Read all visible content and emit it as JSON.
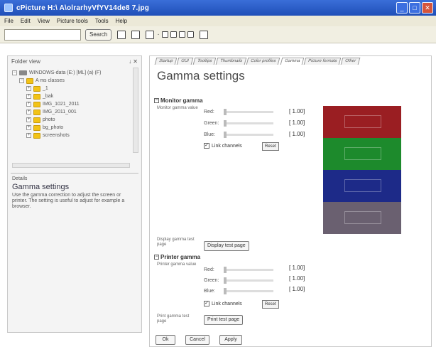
{
  "window": {
    "title": "cPicture  H:\\ A\\olrarhyVfYV14de8 7.jpg",
    "controls": [
      "_",
      "□",
      "✕"
    ]
  },
  "menu": [
    "File",
    "Edit",
    "View",
    "Picture tools",
    "Tools",
    "Help"
  ],
  "toolbar": {
    "search_placeholder": "",
    "search_button": "Search"
  },
  "left_pane": {
    "header": "Folder view",
    "tree": [
      {
        "label": "WINDOWS-data (E:) [ML] (a) (F)",
        "icon": "drive-icon",
        "indent": 0
      },
      {
        "label": "A ms classes",
        "icon": "folder-icon",
        "indent": 1
      },
      {
        "label": "_1",
        "icon": "folder-icon",
        "indent": 2
      },
      {
        "label": "_bak",
        "icon": "folder-icon",
        "indent": 2
      },
      {
        "label": "IMG_1021_2011",
        "icon": "folder-icon",
        "indent": 2
      },
      {
        "label": "IMG_2011_001",
        "icon": "folder-icon",
        "indent": 2
      },
      {
        "label": "photo",
        "icon": "folder-icon",
        "indent": 2
      },
      {
        "label": "bg_photo",
        "icon": "folder-icon",
        "indent": 2
      },
      {
        "label": "screenshots",
        "icon": "folder-icon",
        "indent": 2
      }
    ],
    "details": {
      "label": "Details",
      "title": "Gamma settings",
      "description": "Use the gamma correction to adjust the screen or printer. The setting is useful to adjust for example a browser."
    }
  },
  "tabs": [
    "Startup",
    "GUI",
    "Tooltips",
    "Thumbnails",
    "Color profiles",
    "Gamma",
    "Picture formats",
    "Other"
  ],
  "page": {
    "heading": "Gamma settings",
    "monitor": {
      "title": "Monitor gamma",
      "note": "Monitor gamma value",
      "channels": [
        {
          "label": "Red:",
          "value": "[ 1.00]"
        },
        {
          "label": "Green:",
          "value": "[ 1.00]"
        },
        {
          "label": "Blue:",
          "value": "[ 1.00]"
        }
      ],
      "link_label": "Link channels",
      "reset_label": "Reset",
      "test_note": "Display gamma test page",
      "test_button": "Display test page"
    },
    "printer": {
      "title": "Printer gamma",
      "note": "Printer gamma value",
      "channels": [
        {
          "label": "Red:",
          "value": "[ 1.00]"
        },
        {
          "label": "Green:",
          "value": "[ 1.00]"
        },
        {
          "label": "Blue:",
          "value": "[ 1.00]"
        }
      ],
      "link_label": "Link channels",
      "reset_label": "Reset",
      "test_note": "Print gamma test page",
      "test_button": "Print test page"
    },
    "preview_colors": {
      "red": "#9a1e22",
      "green": "#1d8a2c",
      "blue": "#1d2a88",
      "gray": "#6a6070"
    },
    "buttons": {
      "ok": "Ok",
      "cancel": "Cancel",
      "apply": "Apply"
    }
  }
}
